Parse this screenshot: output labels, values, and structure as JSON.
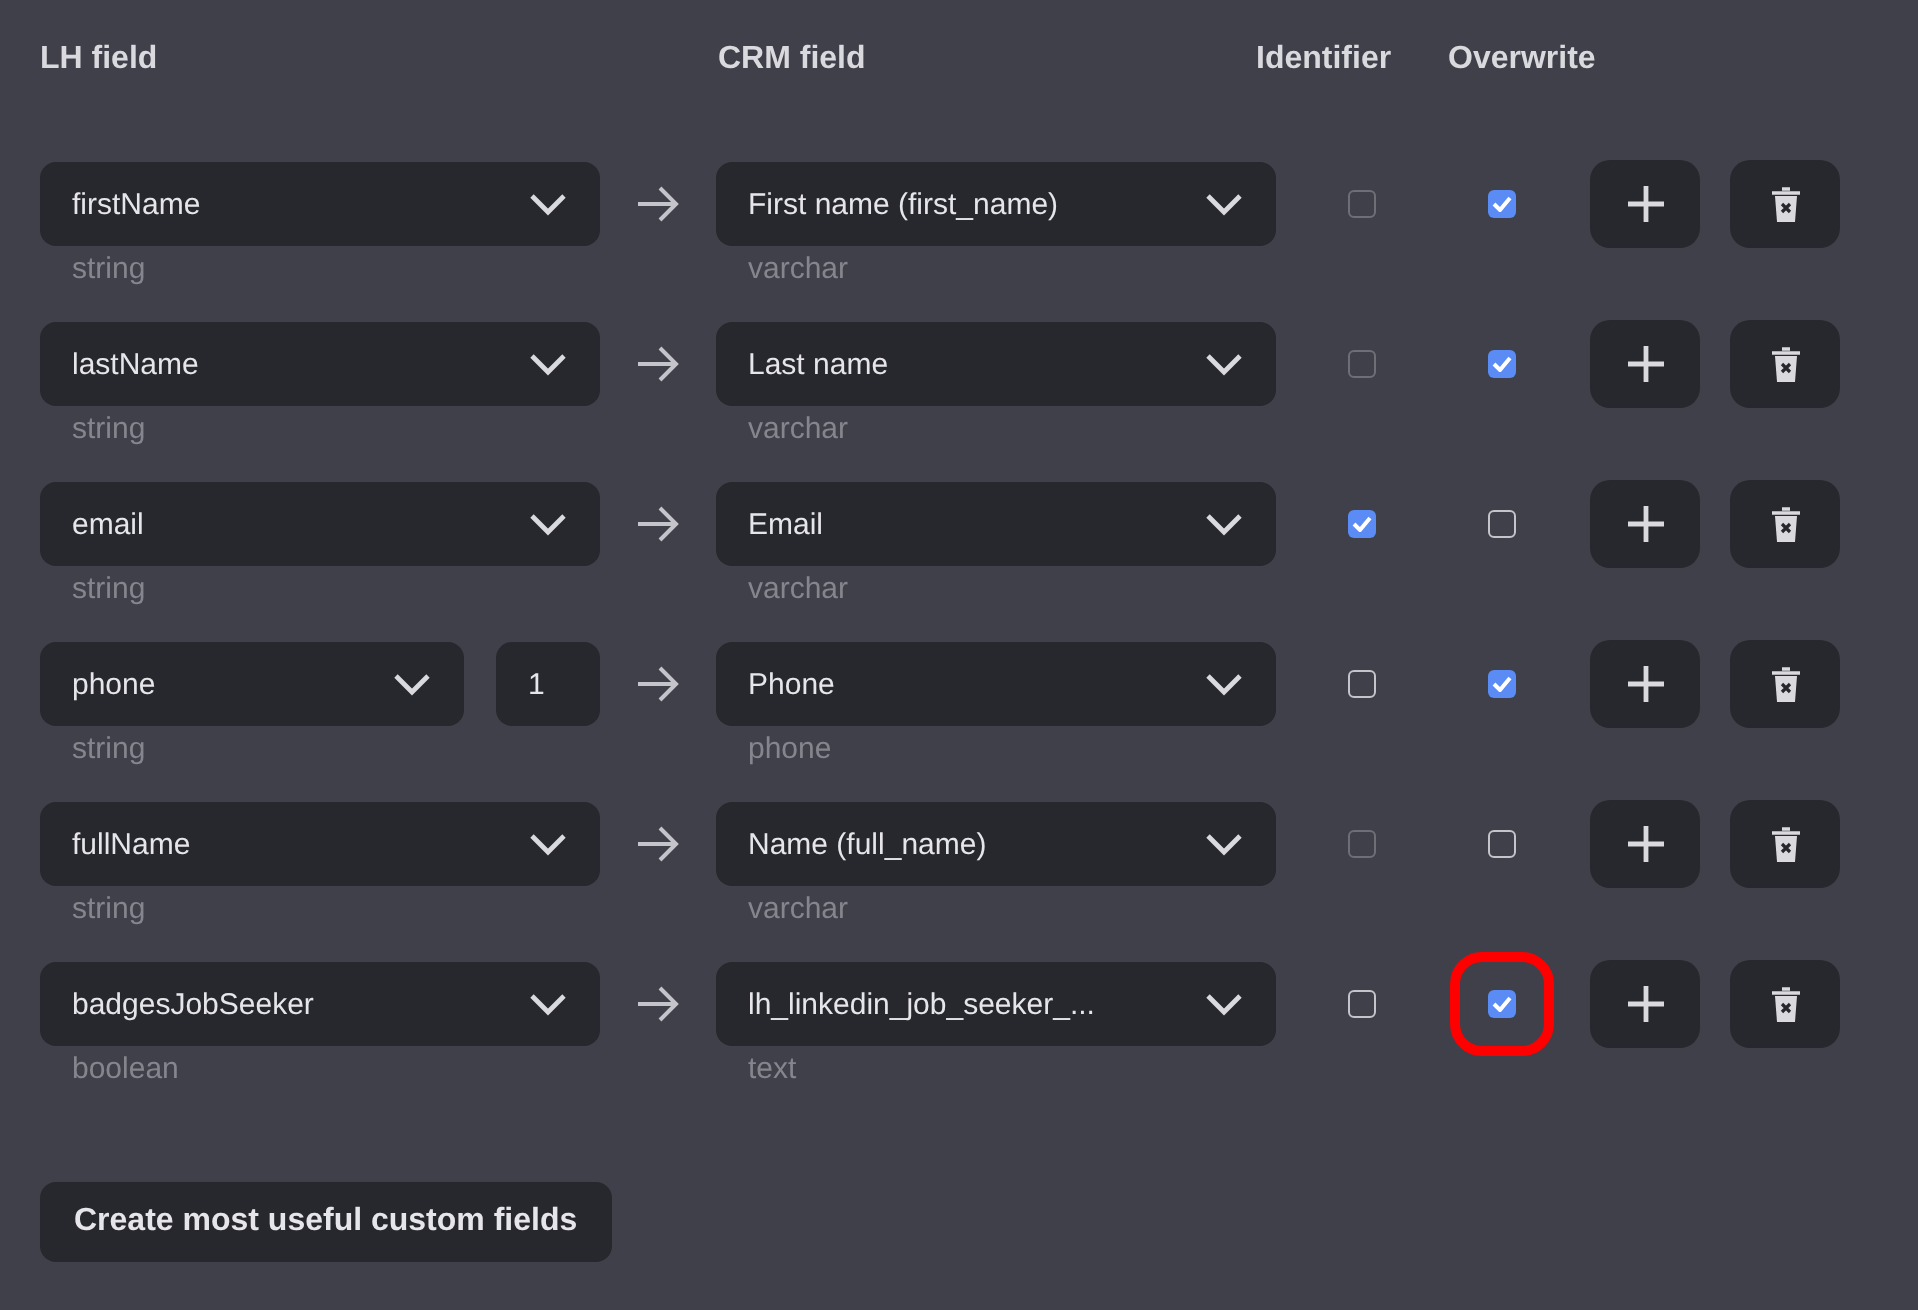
{
  "headers": {
    "lh_field": "LH field",
    "crm_field": "CRM field",
    "identifier": "Identifier",
    "overwrite": "Overwrite"
  },
  "rows": [
    {
      "lh_field": "firstName",
      "lh_type": "string",
      "crm_field": "First name (first_name)",
      "crm_type": "varchar",
      "identifier": {
        "checked": false,
        "disabled": true
      },
      "overwrite": {
        "checked": true,
        "highlighted": false
      }
    },
    {
      "lh_field": "lastName",
      "lh_type": "string",
      "crm_field": "Last name",
      "crm_type": "varchar",
      "identifier": {
        "checked": false,
        "disabled": true
      },
      "overwrite": {
        "checked": true,
        "highlighted": false
      }
    },
    {
      "lh_field": "email",
      "lh_type": "string",
      "crm_field": "Email",
      "crm_type": "varchar",
      "identifier": {
        "checked": true,
        "disabled": false
      },
      "overwrite": {
        "checked": false,
        "highlighted": false
      }
    },
    {
      "lh_field": "phone",
      "lh_index": "1",
      "lh_type": "string",
      "crm_field": "Phone",
      "crm_type": "phone",
      "identifier": {
        "checked": false,
        "disabled": false
      },
      "overwrite": {
        "checked": true,
        "highlighted": false
      }
    },
    {
      "lh_field": "fullName",
      "lh_type": "string",
      "crm_field": "Name (full_name)",
      "crm_type": "varchar",
      "identifier": {
        "checked": false,
        "disabled": true
      },
      "overwrite": {
        "checked": false,
        "highlighted": false
      }
    },
    {
      "lh_field": "badgesJobSeeker",
      "lh_type": "boolean",
      "crm_field": "lh_linkedin_job_seeker_...",
      "crm_type": "text",
      "identifier": {
        "checked": false,
        "disabled": false
      },
      "overwrite": {
        "checked": true,
        "highlighted": true
      }
    }
  ],
  "create_button": "Create most useful custom fields"
}
